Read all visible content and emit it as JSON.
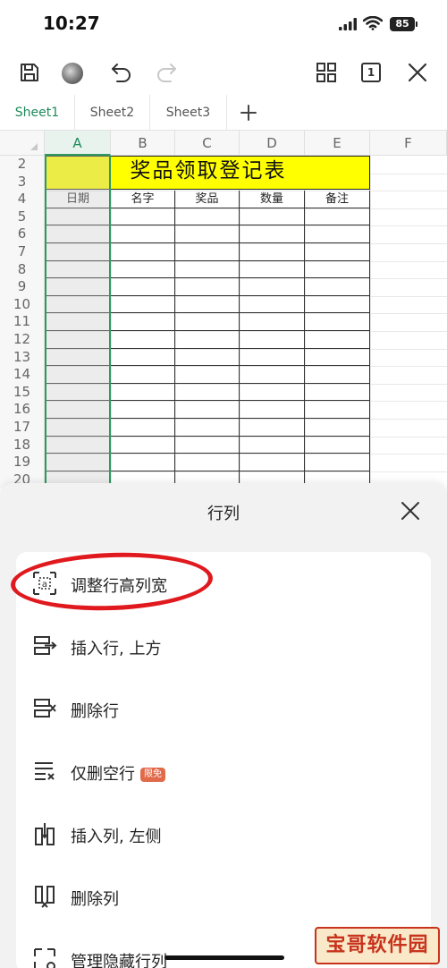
{
  "status_bar": {
    "time": "10:27",
    "battery": "85"
  },
  "toolbar": {
    "icons": [
      "save-icon",
      "avatar",
      "undo-icon",
      "redo-icon",
      "grid-view-icon",
      "page-count-icon",
      "close-icon"
    ],
    "page_count": "1"
  },
  "sheet_tabs": [
    {
      "label": "Sheet1",
      "active": true
    },
    {
      "label": "Sheet2",
      "active": false
    },
    {
      "label": "Sheet3",
      "active": false
    }
  ],
  "grid": {
    "columns": [
      "A",
      "B",
      "C",
      "D",
      "E",
      "F"
    ],
    "rows": [
      "2",
      "3",
      "4",
      "5",
      "6",
      "7",
      "8",
      "9",
      "10",
      "11",
      "12",
      "13",
      "14",
      "15",
      "16",
      "17",
      "18",
      "19",
      "20"
    ],
    "title": "奖品领取登记表",
    "headers": [
      "日期",
      "名字",
      "奖品",
      "数量",
      "备注"
    ],
    "selected_column": "A",
    "title_fill": "#ffff00",
    "accent": "#2e9a63"
  },
  "sheet": {
    "title": "行列",
    "items": [
      {
        "label": "调整行高列宽",
        "icon": "adjust-size-icon",
        "badge": ""
      },
      {
        "label": "插入行, 上方",
        "icon": "insert-row-icon",
        "badge": ""
      },
      {
        "label": "删除行",
        "icon": "delete-row-icon",
        "badge": ""
      },
      {
        "label": "仅删空行",
        "icon": "delete-empty-rows-icon",
        "badge": "限免"
      },
      {
        "label": "插入列, 左侧",
        "icon": "insert-column-icon",
        "badge": ""
      },
      {
        "label": "删除列",
        "icon": "delete-column-icon",
        "badge": ""
      },
      {
        "label": "管理隐藏行列",
        "icon": "manage-hidden-icon",
        "badge": ""
      }
    ],
    "highlight_color": "#e0191e"
  },
  "watermark": {
    "text": "宝哥软件园"
  }
}
